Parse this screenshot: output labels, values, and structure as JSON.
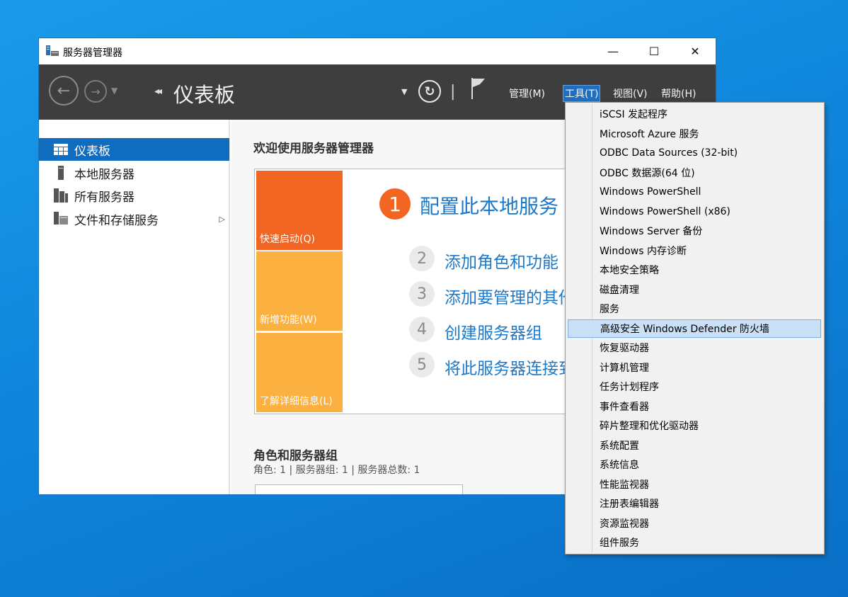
{
  "window": {
    "title": "服务器管理器",
    "controls": {
      "minimize": "—",
      "maximize": "☐",
      "close": "✕"
    }
  },
  "toolbar": {
    "breadcrumb": "仪表板",
    "menus": [
      "管理(M)",
      "工具(T)",
      "视图(V)",
      "帮助(H)"
    ],
    "active_menu": "工具(T)"
  },
  "sidebar": {
    "items": [
      {
        "label": "仪表板",
        "icon": "dashboard-icon",
        "active": true
      },
      {
        "label": "本地服务器",
        "icon": "server-icon",
        "active": false
      },
      {
        "label": "所有服务器",
        "icon": "servers-icon",
        "active": false
      },
      {
        "label": "文件和存储服务",
        "icon": "storage-icon",
        "active": false,
        "expandable": true
      }
    ]
  },
  "main": {
    "welcome_title": "欢迎使用服务器管理器",
    "tiles": [
      "快速启动(Q)",
      "新增功能(W)",
      "了解详细信息(L)"
    ],
    "steps": [
      {
        "num": "1",
        "label": "配置此本地服务"
      },
      {
        "num": "2",
        "label": "添加角色和功能"
      },
      {
        "num": "3",
        "label": "添加要管理的其他"
      },
      {
        "num": "4",
        "label": "创建服务器组"
      },
      {
        "num": "5",
        "label": "将此服务器连接到"
      }
    ],
    "roles_title": "角色和服务器组",
    "roles_subtitle": "角色: 1 | 服务器组: 1 | 服务器总数: 1"
  },
  "tools_menu": {
    "highlighted": "高级安全 Windows Defender 防火墙",
    "items": [
      "iSCSI 发起程序",
      "Microsoft Azure 服务",
      "ODBC Data Sources (32-bit)",
      "ODBC 数据源(64 位)",
      "Windows PowerShell",
      "Windows PowerShell (x86)",
      "Windows Server 备份",
      "Windows 内存诊断",
      "本地安全策略",
      "磁盘清理",
      "服务",
      "高级安全 Windows Defender 防火墙",
      "恢复驱动器",
      "计算机管理",
      "任务计划程序",
      "事件查看器",
      "碎片整理和优化驱动器",
      "系统配置",
      "系统信息",
      "性能监视器",
      "注册表编辑器",
      "资源监视器",
      "组件服务"
    ]
  },
  "colors": {
    "desktop": "#0f86dc",
    "toolbar": "#3e3e3e",
    "accent": "#0f6cbf",
    "quick_start": "#f26522",
    "tile_secondary": "#fbb040",
    "link": "#1c79c9",
    "menu_highlight": "#c9e0f7"
  }
}
